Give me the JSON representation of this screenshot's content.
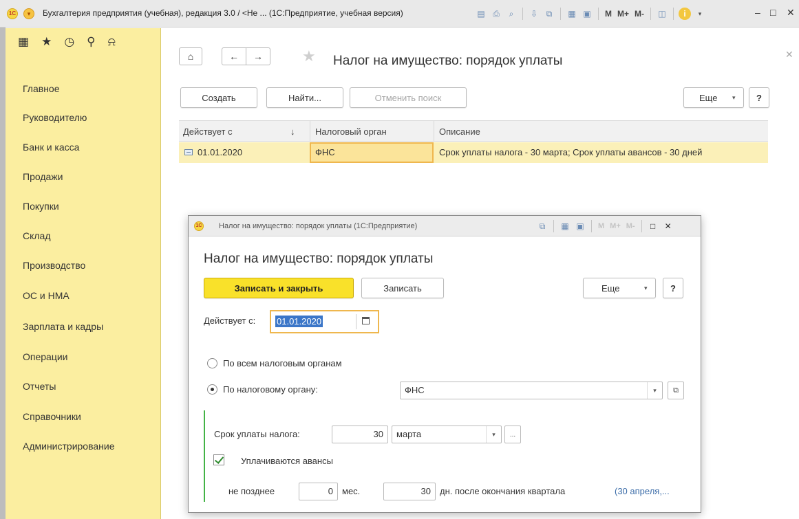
{
  "window": {
    "title": "Бухгалтерия предприятия (учебная), редакция 3.0 / <Не ...  (1С:Предприятие, учебная версия)",
    "logo": "1C",
    "toolbar_text": {
      "m": "M",
      "mplus": "M+",
      "mminus": "M-",
      "info": "i"
    },
    "controls": {
      "minimize": "–",
      "maximize": "□",
      "close": "✕"
    }
  },
  "sidebar": {
    "items": [
      {
        "label": "Главное"
      },
      {
        "label": "Руководителю"
      },
      {
        "label": "Банк и касса"
      },
      {
        "label": "Продажи"
      },
      {
        "label": "Покупки"
      },
      {
        "label": "Склад"
      },
      {
        "label": "Производство"
      },
      {
        "label": "ОС и НМА"
      },
      {
        "label": "Зарплата и кадры"
      },
      {
        "label": "Операции"
      },
      {
        "label": "Отчеты"
      },
      {
        "label": "Справочники"
      },
      {
        "label": "Администрирование"
      }
    ]
  },
  "list_form": {
    "title": "Налог на имущество: порядок уплаты",
    "buttons": {
      "create": "Создать",
      "find": "Найти...",
      "cancel_search": "Отменить поиск",
      "more": "Еще",
      "help": "?"
    },
    "columns": [
      {
        "label": "Действует с",
        "sort": "↓"
      },
      {
        "label": "Налоговый орган"
      },
      {
        "label": "Описание"
      }
    ],
    "rows": [
      {
        "date": "01.01.2020",
        "authority": "ФНС",
        "description": "Срок уплаты налога - 30 марта; Срок уплаты авансов -  30 дней"
      }
    ]
  },
  "dialog": {
    "bar_title": "Налог на имущество: порядок уплаты  (1С:Предприятие)",
    "title": "Налог на имущество: порядок уплаты",
    "buttons": {
      "save_close": "Записать и закрыть",
      "save": "Записать",
      "more": "Еще",
      "help": "?"
    },
    "effective_label": "Действует с:",
    "effective_value": "01.01.2020",
    "radio_all": "По всем налоговым органам",
    "radio_one": "По налоговому органу:",
    "authority_value": "ФНС",
    "tax_deadline_label": "Срок уплаты налога:",
    "tax_day": "30",
    "tax_month": "марта",
    "more_dots": "...",
    "advances_label": "Уплачиваются авансы",
    "advances_checked": true,
    "not_later_label": "не позднее",
    "months_value": "0",
    "months_unit": "мес.",
    "days_value": "30",
    "days_suffix": "дн. после окончания квартала",
    "dates_link": "(30 апреля,..."
  },
  "colors": {
    "sidebar_bg": "#fbeea0",
    "primary_button": "#f9e12a",
    "selected_row": "#fbf0b8",
    "focus_border": "#efb74e",
    "group_bar": "#43b346",
    "link": "#3b6ca8"
  }
}
